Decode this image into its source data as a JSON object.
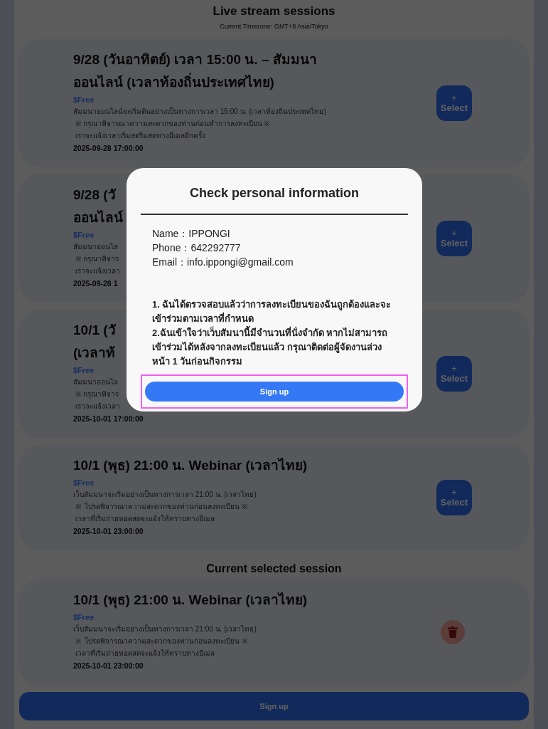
{
  "header": {
    "title": "Live stream sessions",
    "timezone": "Current Timezone: GMT+8 Asia/Tokyo"
  },
  "sessions": [
    {
      "title_lines": [
        "9/28 (วันอาทิตย์) เวลา 15:00 น. – สัมมนา",
        "ออนไลน์ (เวลาท้องถิ่นประเทศไทย)"
      ],
      "price": "$Free",
      "description": [
        "สัมมนาออนไลน์จะเริ่มต้นอย่างเป็นทางการเวลา 15:00 น. (เวลาท้องถิ่นประเทศไทย)",
        " ※ กรุณาพิจารณาความสะดวกของท่านก่อนทำการลงทะเบียน ※",
        " เราจะแจ้งเวลาเริ่มสตรีมสดทางอีเมลอีกครั้ง"
      ],
      "end_time": "2025-09-28 17:00:00",
      "action": {
        "kind": "select",
        "icon": "+",
        "label": "Select"
      }
    },
    {
      "title_lines": [
        "9/28 (วั",
        "ออนไลน์"
      ],
      "price": "$Free",
      "description": [
        "สัมมนาออนไล",
        " ※ กรุณาพิจาร",
        " เราจะแจ้งเวลา"
      ],
      "end_time": "2025-09-28 1",
      "action": {
        "kind": "select",
        "icon": "+",
        "label": "Select"
      }
    },
    {
      "title_lines": [
        "10/1 (วั",
        "(เวลาท้"
      ],
      "price": "$Free",
      "description": [
        "สัมมนาออนไล",
        " ※ กรุณาพิจาร",
        " เราจะแจ้งเวลา"
      ],
      "end_time": "2025-10-01 17:00:00",
      "action": {
        "kind": "select",
        "icon": "+",
        "label": "Select"
      }
    },
    {
      "title_lines": [
        "10/1 (พุธ) 21:00 น. Webinar (เวลาไทย)"
      ],
      "price": "$Free",
      "description": [
        "เว็บสัมมนาจะเริ่มอย่างเป็นทางการเวลา 21:00 น. (เวลาไทย)",
        " ※  โปรดพิจารณาความสะดวกของท่านก่อนลงทะเบียน ※",
        " เวลาที่เริ่มถ่ายทอดสดจะแจ้งให้ทราบทางอีเมล"
      ],
      "end_time": "2025-10-01 23:00:00",
      "action": {
        "kind": "select",
        "icon": "+",
        "label": "Select"
      }
    }
  ],
  "selected_section": {
    "title": "Current selected session",
    "sessions": [
      {
        "title_lines": [
          "10/1 (พุธ) 21:00 น. Webinar (เวลาไทย)"
        ],
        "price": "$Free",
        "description": [
          "เว็บสัมมนาจะเริ่มอย่างเป็นทางการเวลา 21:00 น. (เวลาไทย)",
          " ※  โปรดพิจารณาความสะดวกของท่านก่อนลงทะเบียน ※",
          " เวลาที่เริ่มถ่ายทอดสดจะแจ้งให้ทราบทางอีเมล"
        ],
        "end_time": "2025-10-01 23:00:00",
        "action": {
          "kind": "delete"
        }
      }
    ]
  },
  "signup_button": "Sign up",
  "modal": {
    "title": "Check personal information",
    "info_lines": [
      "Name：IPPONGI",
      "Phone：642292777",
      "Email：info.ippongi@gmail.com"
    ],
    "terms": [
      "1. ฉันได้ตรวจสอบแล้วว่าการลงทะเบียนของฉันถูกต้องและจะเข้าร่วมตามเวลาที่กำหนด",
      "2.ฉันเข้าใจว่าเว็บสัมนานี้มีจำนวนที่นั่งจำกัด หากไม่สามารถเข้าร่วมได้หลังจากลงทะเบียนแล้ว กรุณาติดต่อผู้จัดงานล่วงหน้า 1 วันก่อนกิจกรรม"
    ],
    "button": {
      "label": "Sign up",
      "focused": true
    }
  }
}
